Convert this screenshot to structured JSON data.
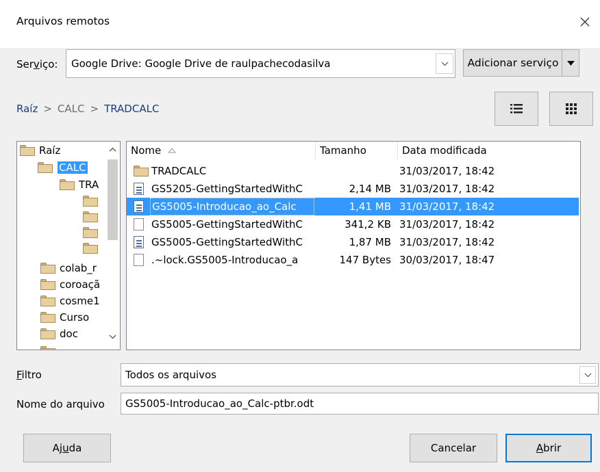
{
  "window": {
    "title": "Arquivos remotos"
  },
  "service": {
    "label_pre": "Ser",
    "label_u": "v",
    "label_post": "iço:",
    "value": "Google Drive: Google Drive de raulpachecodasilva",
    "add_button": "Adicionar serviço"
  },
  "breadcrumb": [
    {
      "label": "Raíz",
      "active": true
    },
    {
      "label": "CALC",
      "active": false
    },
    {
      "label": "TRADCALC",
      "active": true
    }
  ],
  "breadcrumb_sep": ">",
  "tree": {
    "items": [
      {
        "label": "Raíz"
      },
      {
        "label": "CALC"
      },
      {
        "label": "TRA"
      },
      {
        "label": ""
      },
      {
        "label": ""
      },
      {
        "label": ""
      },
      {
        "label": ""
      },
      {
        "label": "colab_r"
      },
      {
        "label": "coroaçã"
      },
      {
        "label": "cosme1"
      },
      {
        "label": "Curso"
      },
      {
        "label": "doc"
      }
    ]
  },
  "columns": {
    "name": "Nome",
    "size": "Tamanho",
    "date": "Data modificada"
  },
  "files": [
    {
      "name": "TRADCALC",
      "size": "",
      "date": "31/03/2017, 18:42",
      "icon": "folder-icon"
    },
    {
      "name": "GS5205-GettingStartedWithC",
      "size": "2,14 MB",
      "date": "31/03/2017, 18:42",
      "icon": "document-icon"
    },
    {
      "name": "GS5005-Introducao_ao_Calc",
      "size": "1,41 MB",
      "date": "31/03/2017, 18:42",
      "icon": "document-icon",
      "selected": true
    },
    {
      "name": "GS5005-GettingStartedWithC",
      "size": "341,2 KB",
      "date": "31/03/2017, 18:42",
      "icon": "file-icon"
    },
    {
      "name": "GS5005-GettingStartedWithC",
      "size": "1,87 MB",
      "date": "31/03/2017, 18:42",
      "icon": "document-icon"
    },
    {
      "name": ".~lock.GS5005-Introducao_a",
      "size": "147 Bytes",
      "date": "30/03/2017, 18:47",
      "icon": "file-icon"
    }
  ],
  "filter": {
    "label_u": "F",
    "label_rest": "iltro",
    "value": "Todos os arquivos"
  },
  "filename": {
    "label": "Nome do arquivo",
    "value": "GS5005-Introducao_ao_Calc-ptbr.odt"
  },
  "buttons": {
    "help_pre": "Aj",
    "help_u": "u",
    "help_post": "da",
    "cancel": "Cancelar",
    "open_u": "A",
    "open_rest": "brir"
  },
  "colors": {
    "selection": "#3399ff",
    "link": "#1a3a86",
    "focus_border": "#0078d7"
  }
}
